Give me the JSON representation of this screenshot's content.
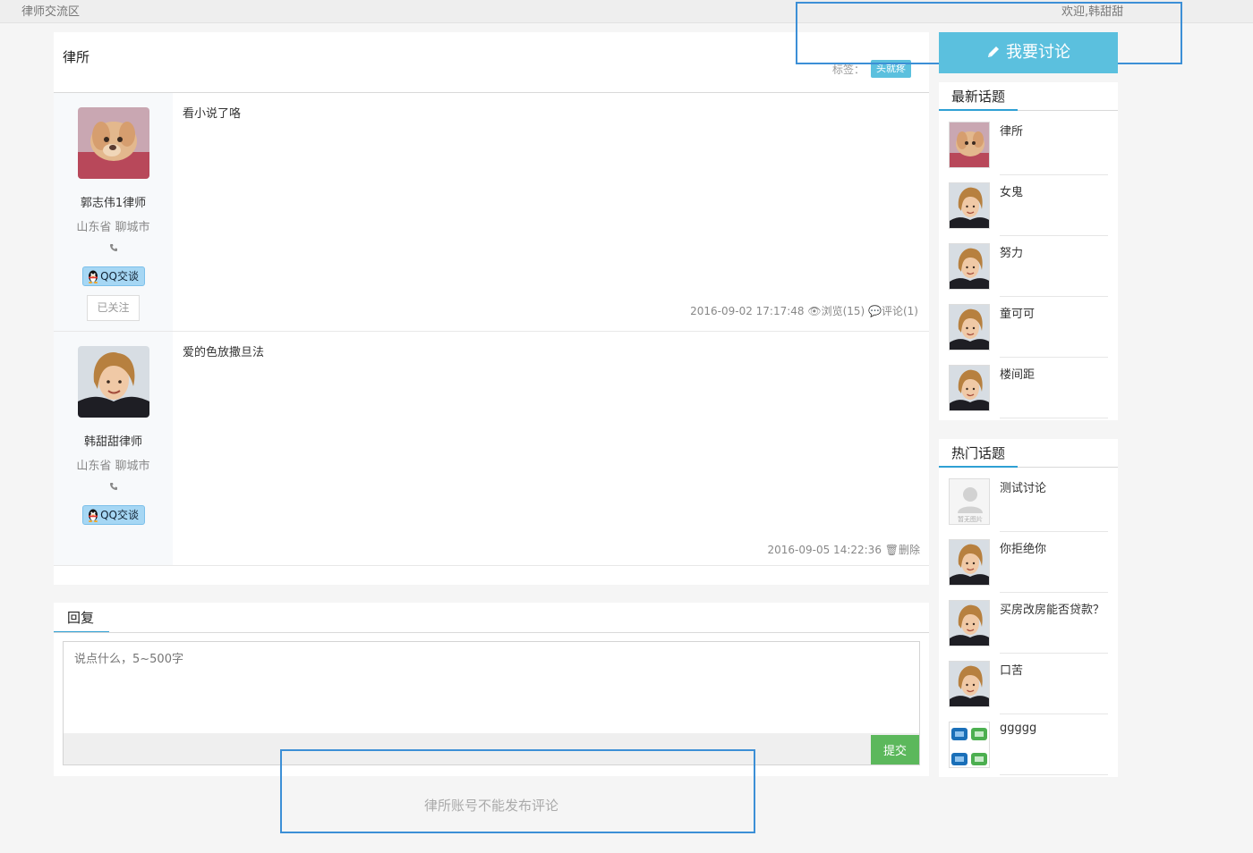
{
  "topbar": {
    "crumb": "律师交流区",
    "welcome": "欢迎,韩甜甜"
  },
  "thread": {
    "title": "律所",
    "tag_label": "标签：",
    "tag": "头就疼"
  },
  "posts": [
    {
      "author": "郭志伟1律师",
      "region": "山东省 聊城市",
      "phone_icon": "phone-icon",
      "qq": "QQ交谈",
      "follow": "已关注",
      "content": "看小说了咯",
      "meta": "2016-09-02 17:17:48 👁浏览(15) 💬评论(1)"
    },
    {
      "author": "韩甜甜律师",
      "region": "山东省 聊城市",
      "phone_icon": "phone-icon",
      "qq": "QQ交谈",
      "content": "爱的色放撒旦法",
      "meta": "2016-09-05 14:22:36 🗑删除"
    }
  ],
  "reply": {
    "tab": "回复",
    "placeholder": "说点什么，5~500字",
    "submit": "提交",
    "notice": "律所账号不能发布评论"
  },
  "sidebar": {
    "discuss_btn": "我要讨论",
    "latest": {
      "title": "最新话题",
      "items": [
        {
          "name": "律所",
          "thumb": "dog"
        },
        {
          "name": "女鬼",
          "thumb": "person"
        },
        {
          "name": "努力",
          "thumb": "person"
        },
        {
          "name": "童可可",
          "thumb": "person"
        },
        {
          "name": "楼间距",
          "thumb": "person"
        }
      ]
    },
    "hot": {
      "title": "热门话题",
      "items": [
        {
          "name": "测试讨论",
          "thumb": "placeholder",
          "placeholder_text": "暂无图片"
        },
        {
          "name": "你拒绝你",
          "thumb": "person"
        },
        {
          "name": "买房改房能否贷款？",
          "thumb": "person"
        },
        {
          "name": "口苦",
          "thumb": "person"
        },
        {
          "name": "ggggg",
          "thumb": "icons"
        }
      ]
    }
  },
  "colors": {
    "accent": "#5bc0de",
    "tab_underline": "#2ea0d4",
    "submit": "#5cb85c",
    "highlight": "#3c8fd6"
  }
}
